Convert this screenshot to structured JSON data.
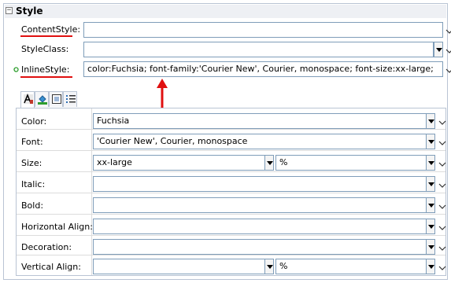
{
  "section": {
    "title": "Style"
  },
  "content_style": {
    "label": "ContentStyle:",
    "value": ""
  },
  "style_class": {
    "label": "StyleClass:",
    "value": ""
  },
  "inline_style": {
    "label": "InlineStyle:",
    "value": "color:Fuchsia; font-family:'Courier New', Courier, monospace; font-size:xx-large;"
  },
  "tabs": [
    {
      "icon": "text-style-icon"
    },
    {
      "icon": "background-fill-icon"
    },
    {
      "icon": "border-box-icon"
    },
    {
      "icon": "list-format-icon"
    }
  ],
  "props": {
    "color": {
      "label": "Color:",
      "value": "Fuchsia"
    },
    "font": {
      "label": "Font:",
      "value": "'Courier New', Courier, monospace"
    },
    "size": {
      "label": "Size:",
      "value": "xx-large",
      "unit": "%"
    },
    "italic": {
      "label": "Italic:",
      "value": ""
    },
    "bold": {
      "label": "Bold:",
      "value": ""
    },
    "halign": {
      "label": "Horizontal Align:",
      "value": ""
    },
    "decoration": {
      "label": "Decoration:",
      "value": ""
    },
    "valign": {
      "label": "Vertical Align:",
      "value": "",
      "unit": "%"
    }
  },
  "colors": {
    "annotation_red": "#e01010",
    "border": "#7f9db9",
    "modified_dot": "#2e9e2e"
  }
}
